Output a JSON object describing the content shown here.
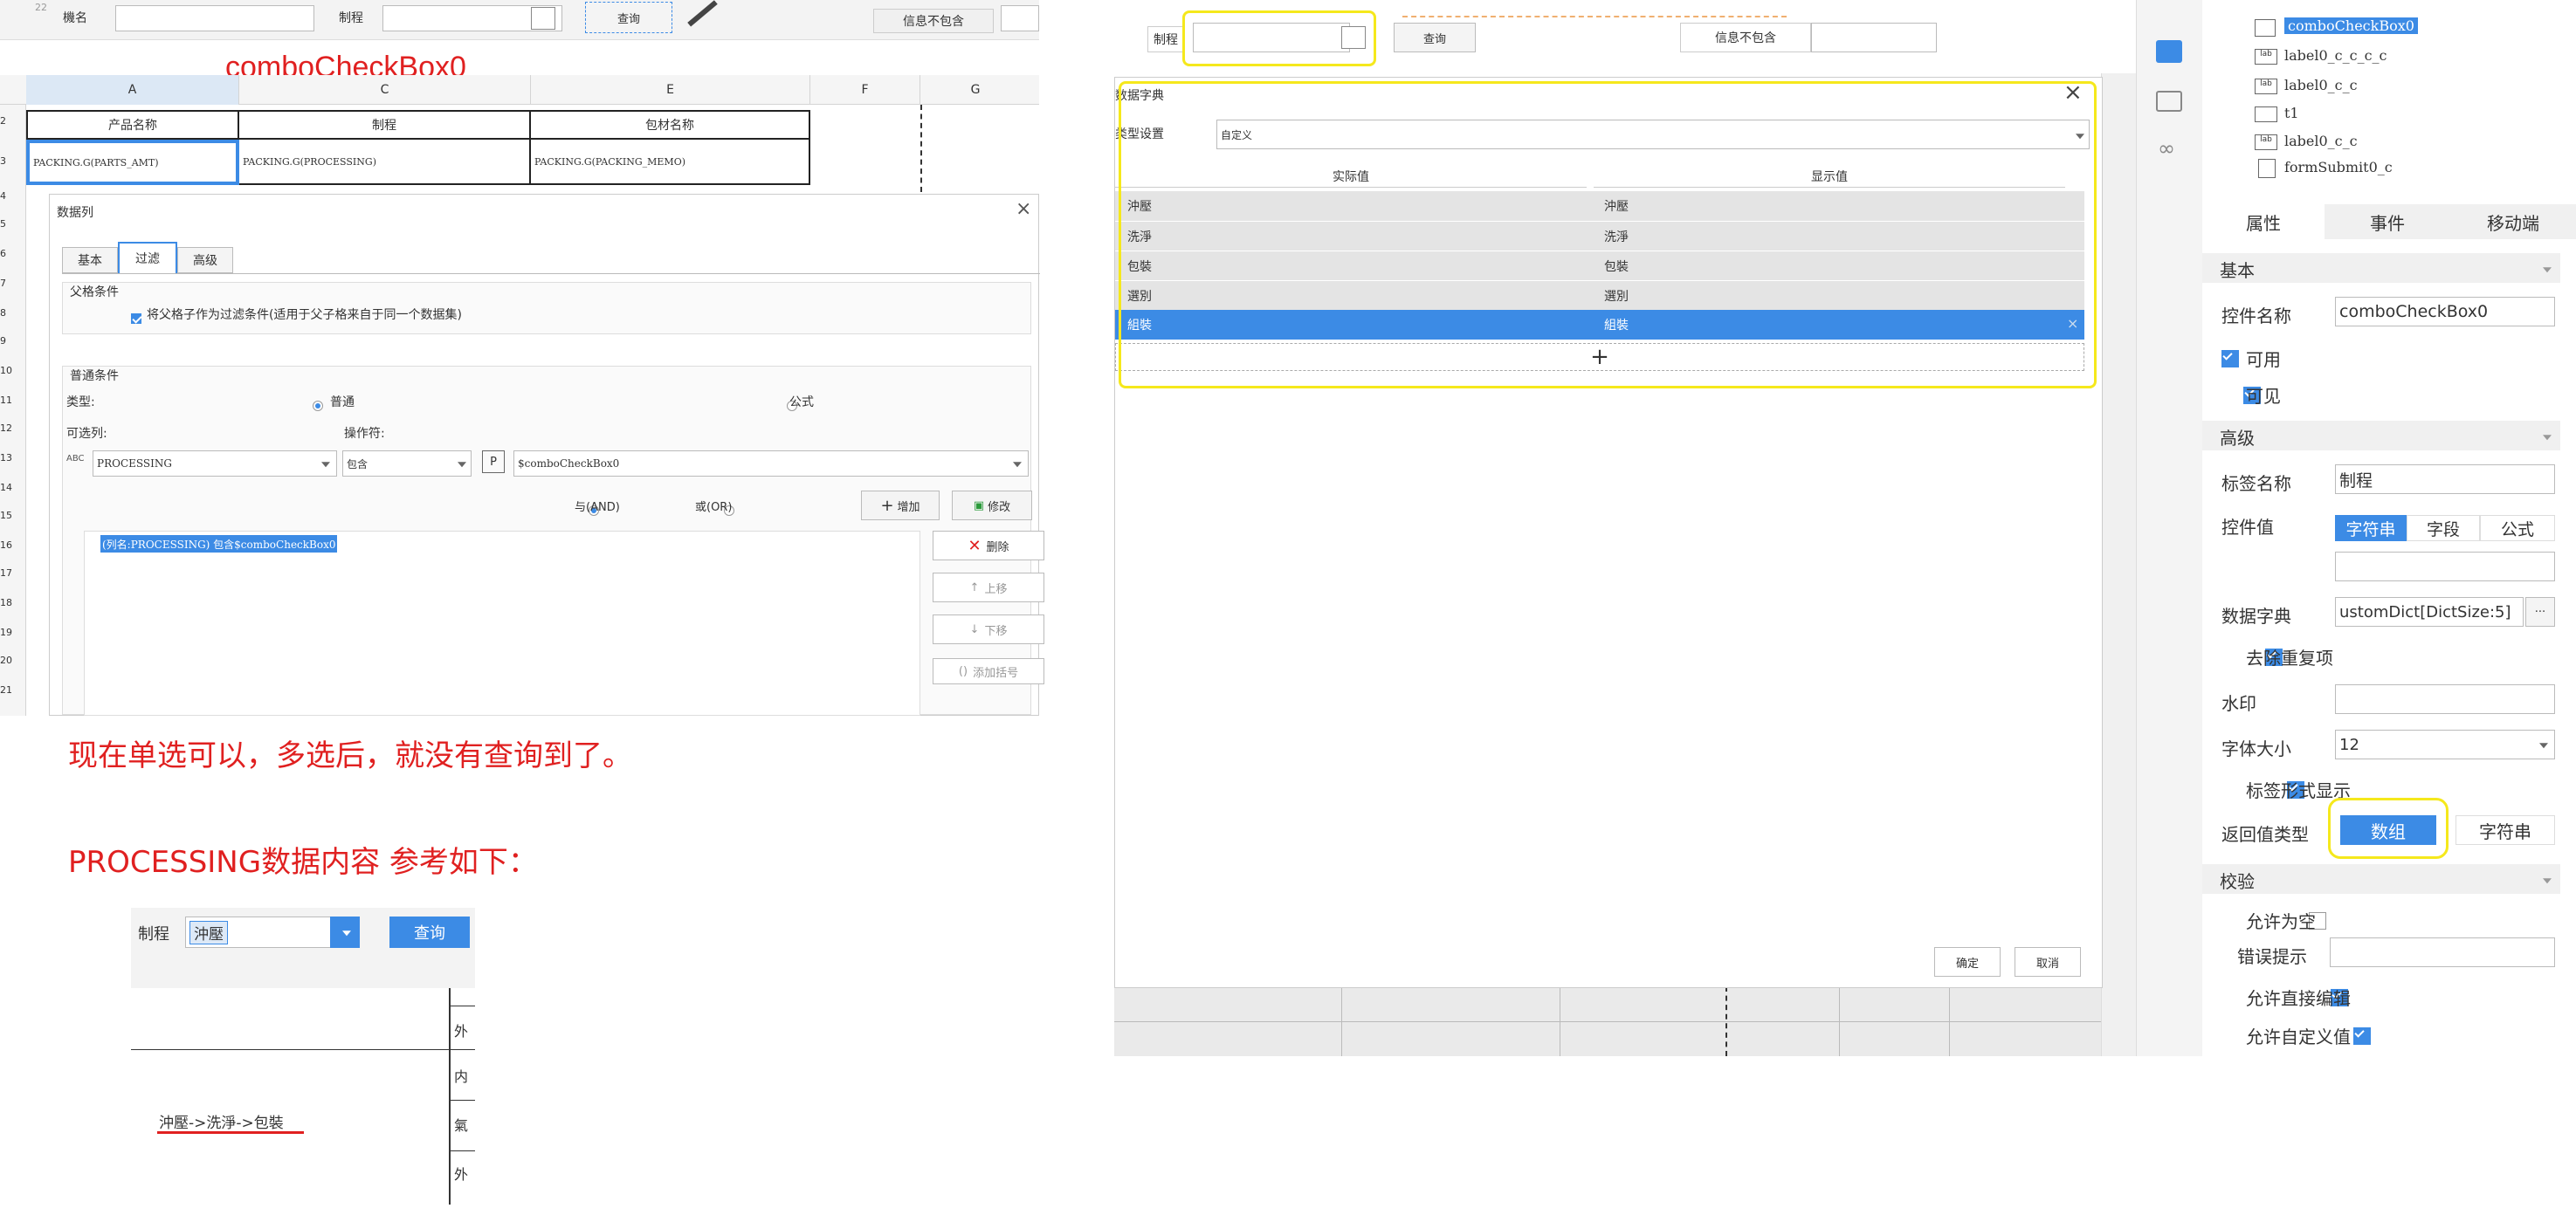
{
  "left_spreadsheet": {
    "toolbar": {
      "label_model": "機名",
      "label_process": "制程",
      "query": "查询",
      "info_label": "信息不包含",
      "small_id": "22"
    },
    "annotation_top": "comboCheckBox0",
    "columns": [
      "A",
      "C",
      "E",
      "F",
      "G"
    ],
    "row_numbers": [
      "2",
      "3",
      "4",
      "5",
      "6",
      "7",
      "8",
      "9",
      "10",
      "11",
      "12",
      "13",
      "14",
      "15",
      "16",
      "17",
      "18",
      "19",
      "20",
      "21"
    ],
    "headers": [
      "产品名称",
      "制程",
      "包材名称"
    ],
    "formulas": [
      "PACKING.G(PARTS_AMT)",
      "PACKING.G(PROCESSING)",
      "PACKING.G(PACKING_MEMO)"
    ]
  },
  "data_column_dialog": {
    "title": "数据列",
    "tabs": [
      "基本",
      "过滤",
      "高级"
    ],
    "parent_section": "父格条件",
    "parent_checkbox": "将父格子作为过滤条件(适用于父子格来自于同一个数据集)",
    "normal_section": "普通条件",
    "type_label": "类型:",
    "type_normal": "普通",
    "type_formula": "公式",
    "col_label": "可选列:",
    "op_label": "操作符:",
    "col_value": "PROCESSING",
    "op_value": "包含",
    "param_value": "$comboCheckBox0",
    "and_label": "与(AND)",
    "or_label": "或(OR)",
    "add_btn": "增加",
    "edit_btn": "修改",
    "delete_btn": "删除",
    "up_btn": "上移",
    "down_btn": "下移",
    "bracket_btn": "添加括号",
    "condition": "(列名:PROCESSING) 包含$comboCheckBox0"
  },
  "notes": {
    "line1": "现在单选可以，多选后，就没有查询到了。",
    "line2": "PROCESSING数据内容 参考如下："
  },
  "inset": {
    "label": "制程",
    "value": "沖壓",
    "query": "查询",
    "right_cells": [
      "外",
      "内",
      "氣",
      "外"
    ],
    "path_text": "沖壓->洗淨->包裝"
  },
  "right_toolbar": {
    "label_process": "制程",
    "query": "查询",
    "info_label": "信息不包含"
  },
  "dict_dialog": {
    "title": "数据字典",
    "type_label": "类型设置",
    "type_value": "自定义",
    "col_actual": "实际值",
    "col_display": "显示值",
    "rows": [
      {
        "actual": "沖壓",
        "display": "沖壓"
      },
      {
        "actual": "洗淨",
        "display": "洗淨"
      },
      {
        "actual": "包裝",
        "display": "包裝"
      },
      {
        "actual": "選別",
        "display": "選別"
      },
      {
        "actual": "組裝",
        "display": "組裝"
      }
    ],
    "add": "+",
    "ok": "确定",
    "cancel": "取消"
  },
  "tree": {
    "items": [
      "comboCheckBox0",
      "label0_c_c_c_c",
      "label0_c_c",
      "t1",
      "label0_c_c",
      "formSubmit0_c"
    ]
  },
  "props": {
    "tabs": [
      "属性",
      "事件",
      "移动端"
    ],
    "basic": "基本",
    "ctrl_name_label": "控件名称",
    "ctrl_name_value": "comboCheckBox0",
    "enabled": "可用",
    "visible": "可见",
    "advanced": "高级",
    "tag_name_label": "标签名称",
    "tag_name_value": "制程",
    "ctrl_value_label": "控件值",
    "value_tabs": [
      "字符串",
      "字段",
      "公式"
    ],
    "dict_label": "数据字典",
    "dict_value": "ustomDict[DictSize:5]",
    "dict_more": "···",
    "dedupe": "去除重复项",
    "watermark": "水印",
    "font_size_label": "字体大小",
    "font_size_value": "12",
    "tag_display": "标签形式显示",
    "return_label": "返回值类型",
    "return_array": "数组",
    "return_string": "字符串",
    "validate": "校验",
    "allow_empty": "允许为空",
    "error_tip": "错误提示",
    "allow_edit": "允许直接编辑",
    "allow_custom": "允许自定义值"
  },
  "colors": {
    "accent": "#3c8be5",
    "highlight": "#f5e81c",
    "note_red": "#e02020"
  }
}
